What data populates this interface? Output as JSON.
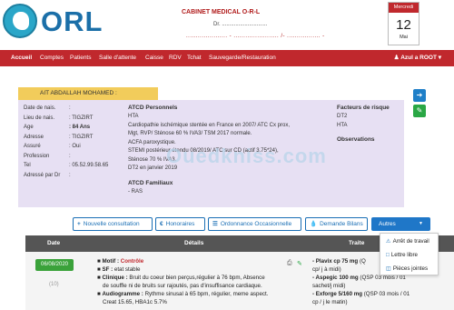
{
  "brand": {
    "logo_text": "ORL"
  },
  "cabinet": {
    "title": "CABINET MEDICAL O-R-L",
    "doctor": "Dr. ..............................",
    "phones": "..................... - .......................  /- ................. -"
  },
  "calendar": {
    "weekday": "Mercredi",
    "day": "12",
    "month": "Mai",
    "accent": "#c0282d"
  },
  "nav": {
    "items": [
      {
        "label": "Accueil"
      },
      {
        "label": "Comptes"
      },
      {
        "label": "Patients"
      },
      {
        "label": "Salle d'attente"
      },
      {
        "label": "Caisse"
      },
      {
        "label": "RDV"
      },
      {
        "label": "Tchat"
      },
      {
        "label": "Sauvegarde/Restauration"
      }
    ],
    "user": "Azul a ROOT",
    "user_icon": "user-icon",
    "bg_color": "#c0282d"
  },
  "patient": {
    "name_bar": "AIT ABDALLAH MOHAMED :",
    "fields": [
      {
        "label": "Date de nais.",
        "value": ":"
      },
      {
        "label": "Lieu de nais.",
        "value": ": TIGZIRT"
      },
      {
        "label": "Age",
        "value": ": 84 Ans"
      },
      {
        "label": "Adresse",
        "value": ": TIGZIRT"
      },
      {
        "label": "Assuré",
        "value": ": Oui"
      },
      {
        "label": "Profession",
        "value": ":"
      },
      {
        "label": "Tel",
        "value": ": 05.52.99.58.65"
      },
      {
        "label": "Adressé par Dr",
        "value": ":"
      }
    ],
    "atcd_personnels_title": "ATCD Personnels",
    "atcd_personnels": [
      "HTA",
      "Cardiopathie ischémique stentée en France en 2007/ ATC Cx prox,",
      "Mgt, RVP/ Sténose 60 % IVA3/ TSM 2017 normale.",
      "ACFA paroxystique.",
      "STEMI postérieur étendu 08/2019/ ATC sur CD (actif 3.75*24),",
      "Sténose 70 % IVA3.",
      "DT2 en janvier 2019"
    ],
    "atcd_familiaux_title": "ATCD Familiaux",
    "atcd_familiaux": [
      "- RAS"
    ],
    "facteurs_title": "Facteurs de risque",
    "facteurs": [
      "DT2",
      "HTA"
    ],
    "observations_title": "Observations",
    "panel_color": "#e7e0f3"
  },
  "side_buttons": [
    {
      "icon": "arrow-left-icon",
      "color": "#1f7fc8"
    },
    {
      "icon": "pencil-icon",
      "color": "#2aa745"
    }
  ],
  "watermark": "Ouedkniss.com",
  "actions": {
    "nouvelle": "Nouvelle consultation",
    "honoraires": "Honoraires",
    "ordonnance": "Ordonnance Occasionnelle",
    "demande": "Demande Bilans",
    "autres": "Autres",
    "dropdown": [
      {
        "label": "Arrêt de travail",
        "icon": "warning-icon"
      },
      {
        "label": "Lettre libre",
        "icon": "document-icon"
      },
      {
        "label": "Pièces jointes",
        "icon": "folder-icon"
      }
    ]
  },
  "table": {
    "headers": {
      "date": "Date",
      "details": "Détails",
      "traitement": "Traite"
    },
    "row": {
      "date": "06/08/2020",
      "date_sub": "(10)",
      "details": [
        {
          "key": "Motif :",
          "val": "Contrôle",
          "red": true
        },
        {
          "key": "SF :",
          "val": " etat stable"
        },
        {
          "key": "Clinique :",
          "val": " Bruit du coeur bien perçus,régulier à 76 bpm, Absence"
        },
        {
          "key": "",
          "val": "de souffle ni de bruits sur rajoutés, pas d'insuffisance cardiaque."
        },
        {
          "key": "Audiogramme :",
          "val": " Rythme sinusal à 65 bpm, régulier, meme aspect."
        },
        {
          "key": "",
          "val": "Creat 15.65, HBA1c 5.7%"
        }
      ],
      "traitement": [
        {
          "key": "- Plavix cp 75 mg",
          "val": " (Q"
        },
        {
          "key": "",
          "val": "cp/ j à midi)"
        },
        {
          "key": "- Aspegic 100 mg",
          "val": " (QSP 03 mois / 01"
        },
        {
          "key": "",
          "val": "sachet/j midi)"
        },
        {
          "key": "- Exforge 5/160 mg",
          "val": " (QSP 03 mois / 01"
        },
        {
          "key": "",
          "val": "cp / j le matin)"
        }
      ]
    }
  }
}
